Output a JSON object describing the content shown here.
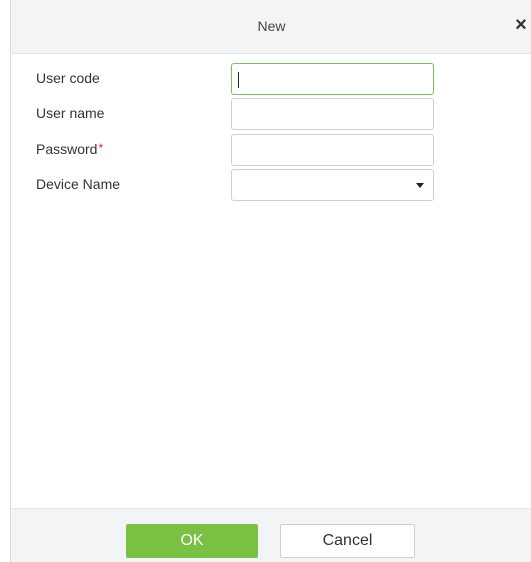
{
  "dialog": {
    "title": "New",
    "close_icon": "close-icon"
  },
  "form": {
    "user_code_label": "User code",
    "user_code_value": "",
    "user_name_label": "User name",
    "user_name_value": "",
    "password_label": "Password",
    "password_required_mark": "*",
    "password_value": "",
    "device_name_label": "Device Name",
    "device_name_value": "",
    "dropdown_icon": "caret-down-icon"
  },
  "footer": {
    "ok_label": "OK",
    "cancel_label": "Cancel"
  },
  "colors": {
    "ok_button": "#7ac143",
    "focus_border": "#79c060",
    "required": "#e02020",
    "header_bg": "#f3f4f6"
  }
}
